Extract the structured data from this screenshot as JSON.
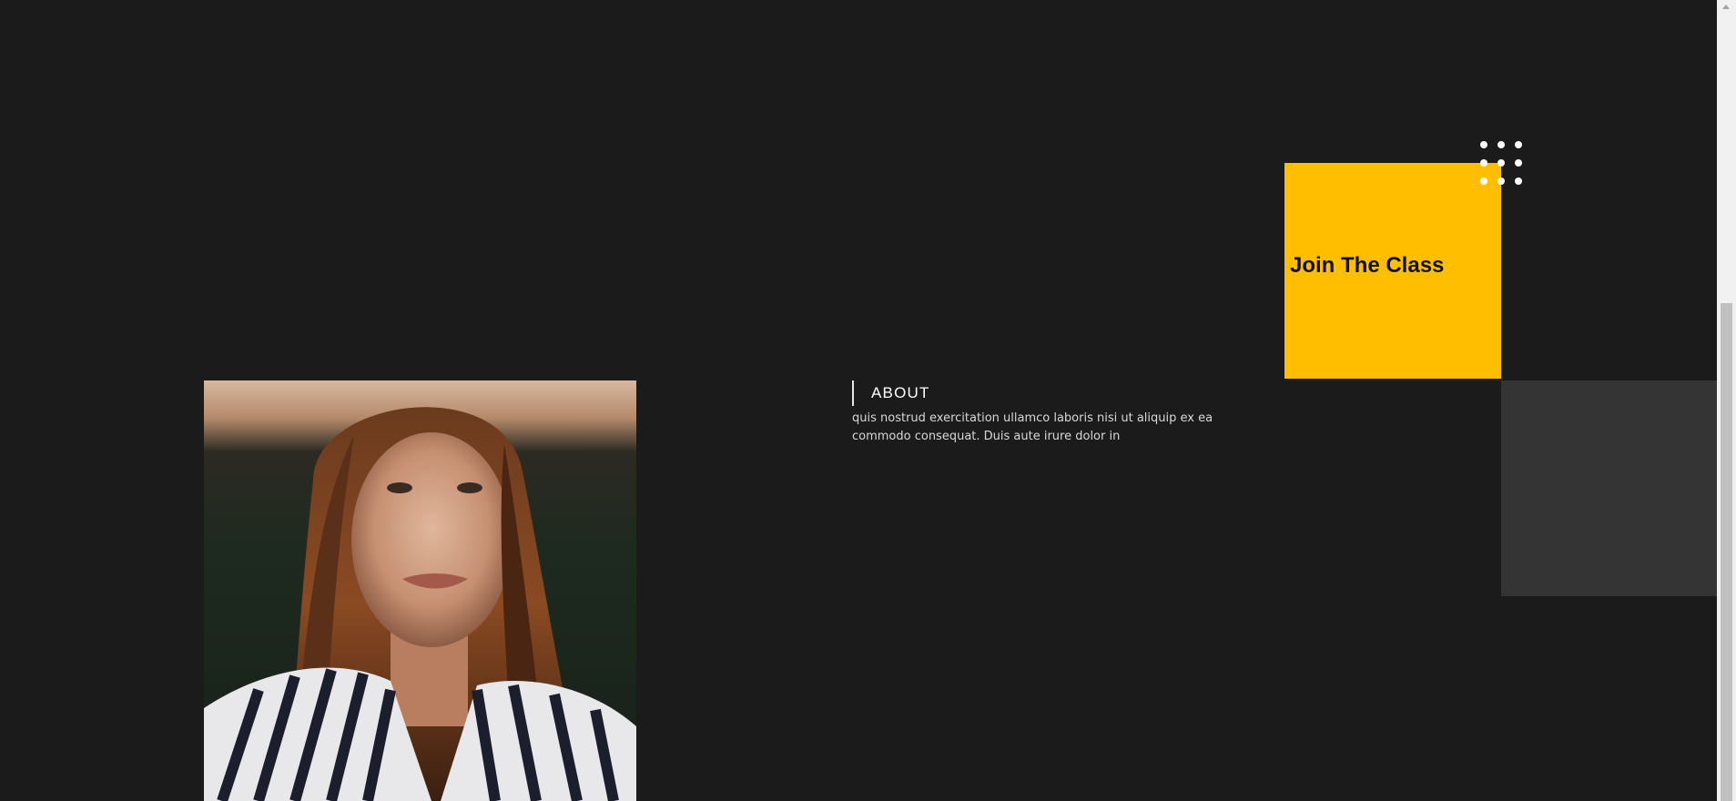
{
  "join": {
    "title": "Join The Class"
  },
  "about": {
    "title": "ABOUT",
    "text": "quis nostrud exercitation ullamco laboris nisi ut aliquip ex ea commodo consequat. Duis aute irure dolor in"
  },
  "colors": {
    "background": "#1b1b1b",
    "accent": "#ffbf00",
    "panel": "#343434"
  }
}
